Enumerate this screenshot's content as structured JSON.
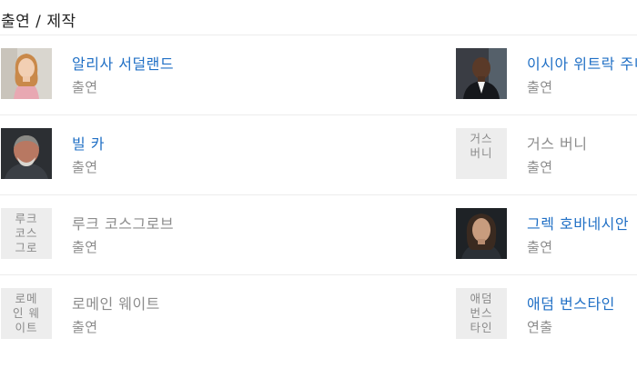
{
  "section": {
    "title": "출연 / 제작"
  },
  "cast": [
    {
      "name": "알리사 서덜랜드",
      "role": "출연",
      "photo": "photo",
      "linked": true
    },
    {
      "name": "이시아 위트락 주니어",
      "role": "출연",
      "photo": "photo",
      "linked": true
    },
    {
      "name": "빌 카",
      "role": "출연",
      "photo": "photo",
      "linked": true
    },
    {
      "name": "거스 버니",
      "role": "출연",
      "photo": "placeholder",
      "placeholder_text": "거스 버니",
      "linked": false
    },
    {
      "name": "루크 코스그로브",
      "role": "출연",
      "photo": "placeholder",
      "placeholder_text": "루크 코스그로",
      "linked": false
    },
    {
      "name": "그렉 호바네시안",
      "role": "출연",
      "photo": "photo",
      "linked": true
    },
    {
      "name": "로메인 웨이트",
      "role": "출연",
      "photo": "placeholder",
      "placeholder_text": "로메인 웨이트",
      "linked": false
    },
    {
      "name": "애덤 번스타인",
      "role": "연출",
      "photo": "placeholder",
      "placeholder_text": "애덤 번스타인",
      "linked": true
    }
  ],
  "colors": {
    "link": "#1f6fc5",
    "muted": "#8c8c8c",
    "divider": "#ececec",
    "placeholder_bg": "#ededed"
  }
}
